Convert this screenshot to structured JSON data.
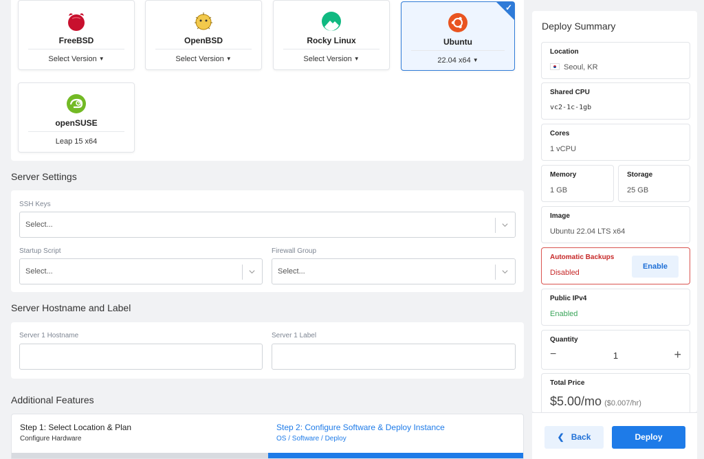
{
  "os_cards": [
    {
      "name": "FreeBSD",
      "version": "Select Version",
      "icon": "freebsd-icon",
      "selected": false
    },
    {
      "name": "OpenBSD",
      "version": "Select Version",
      "icon": "openbsd-icon",
      "selected": false
    },
    {
      "name": "Rocky Linux",
      "version": "Select Version",
      "icon": "rocky-linux-icon",
      "selected": false
    },
    {
      "name": "Ubuntu",
      "version": "22.04 x64",
      "icon": "ubuntu-icon",
      "selected": true
    },
    {
      "name": "openSUSE",
      "version": "Leap 15 x64",
      "icon": "opensuse-icon",
      "selected": false
    }
  ],
  "server_settings": {
    "title": "Server Settings",
    "ssh_label": "SSH Keys",
    "ssh_placeholder": "Select...",
    "startup_label": "Startup Script",
    "startup_placeholder": "Select...",
    "firewall_label": "Firewall Group",
    "firewall_placeholder": "Select..."
  },
  "hostname_section": {
    "title": "Server Hostname and Label",
    "hostname_label": "Server 1 Hostname",
    "hostname_value": "",
    "label_label": "Server 1 Label",
    "label_value": ""
  },
  "additional_features": {
    "title": "Additional Features"
  },
  "steps": [
    {
      "title": "Step 1: Select Location & Plan",
      "subtitle": "Configure Hardware",
      "active": false
    },
    {
      "title": "Step 2: Configure Software & Deploy Instance",
      "subtitle": "OS / Software / Deploy",
      "active": true
    }
  ],
  "summary": {
    "title": "Deploy Summary",
    "location_label": "Location",
    "location_value": "Seoul, KR",
    "cpu_label": "Shared CPU",
    "cpu_value": "vc2-1c-1gb",
    "cores_label": "Cores",
    "cores_value": "1 vCPU",
    "memory_label": "Memory",
    "memory_value": "1 GB",
    "storage_label": "Storage",
    "storage_value": "25 GB",
    "image_label": "Image",
    "image_value": "Ubuntu 22.04 LTS x64",
    "backups_label": "Automatic Backups",
    "backups_value": "Disabled",
    "backups_button": "Enable",
    "ipv4_label": "Public IPv4",
    "ipv4_value": "Enabled",
    "quantity_label": "Quantity",
    "quantity_value": "1",
    "quantity_minus": "−",
    "quantity_plus": "+",
    "price_label": "Total Price",
    "price_value": "$5.00/mo",
    "price_hourly": "($0.007/hr)"
  },
  "footer": {
    "back_label": "Back",
    "deploy_label": "Deploy",
    "back_icon": "chevron-left-icon"
  },
  "colors": {
    "accent": "#1e7be8",
    "danger": "#d9534f",
    "success": "#3aa55a"
  }
}
